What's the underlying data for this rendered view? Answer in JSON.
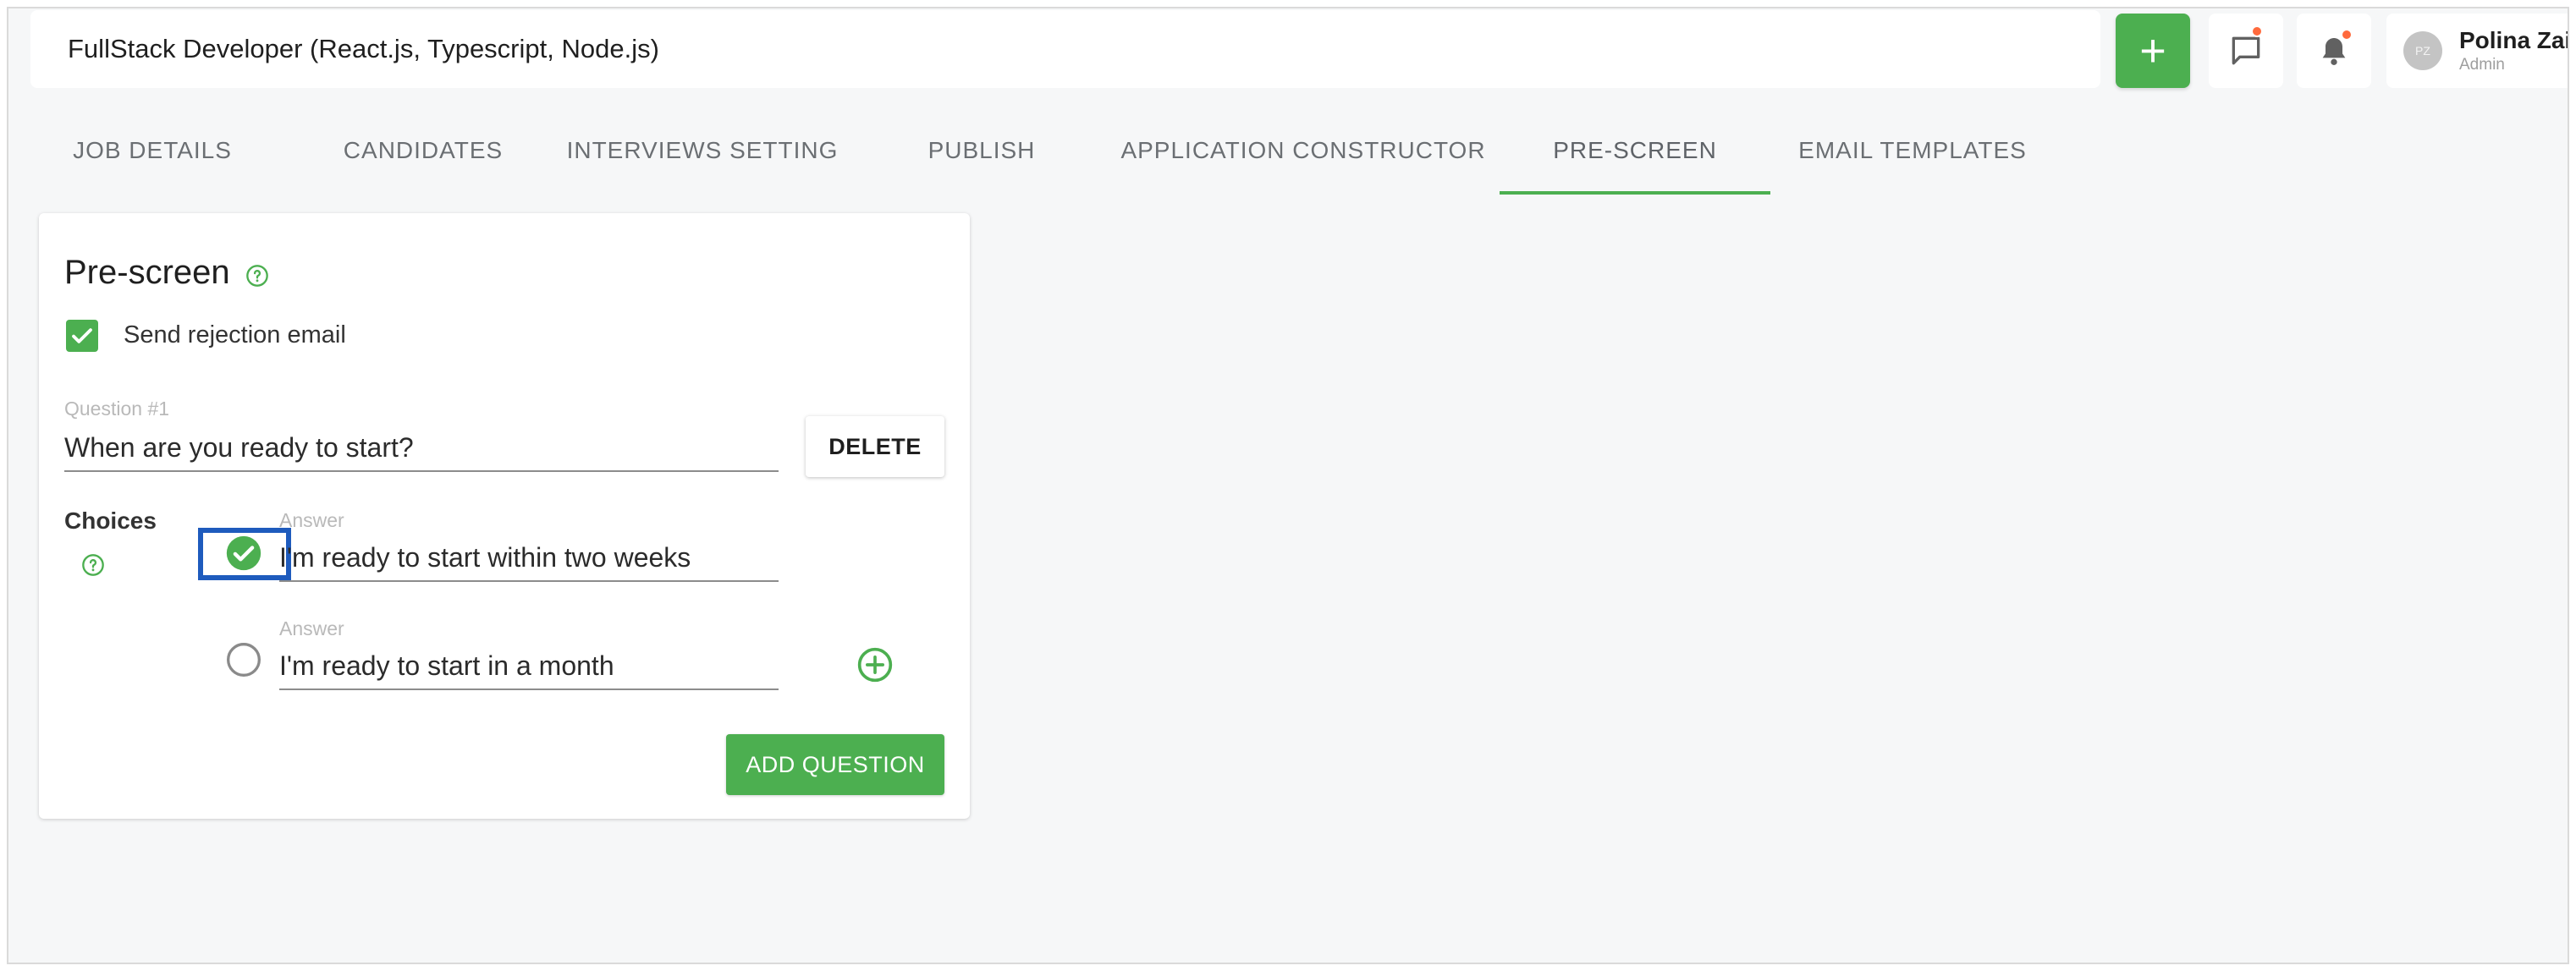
{
  "header": {
    "job_title": "FullStack Developer (React.js, Typescript, Node.js)",
    "add_button_label": "+",
    "user": {
      "initials": "PZ",
      "name": "Polina Zait",
      "role": "Admin"
    }
  },
  "tabs": [
    {
      "label": "JOB DETAILS",
      "active": false
    },
    {
      "label": "CANDIDATES",
      "active": false
    },
    {
      "label": "INTERVIEWS SETTING",
      "active": false
    },
    {
      "label": "PUBLISH",
      "active": false
    },
    {
      "label": "APPLICATION CONSTRUCTOR",
      "active": false
    },
    {
      "label": "PRE-SCREEN",
      "active": true
    },
    {
      "label": "EMAIL TEMPLATES",
      "active": false
    }
  ],
  "prescreen": {
    "title": "Pre-screen",
    "send_rejection_label": "Send rejection email",
    "send_rejection_checked": true,
    "question_caption": "Question #1",
    "question_value": "When are you ready to start?",
    "delete_label": "DELETE",
    "choices_label": "Choices",
    "answers": [
      {
        "caption": "Answer",
        "value": "I'm ready to start within two weeks",
        "correct": true
      },
      {
        "caption": "Answer",
        "value": "I'm ready to start in a month",
        "correct": false
      }
    ],
    "add_question_label": "ADD QUESTION"
  },
  "colors": {
    "accent_green": "#4caf50",
    "notification_dot": "#ff6a3d",
    "highlight_blue": "#1e5bbd"
  }
}
